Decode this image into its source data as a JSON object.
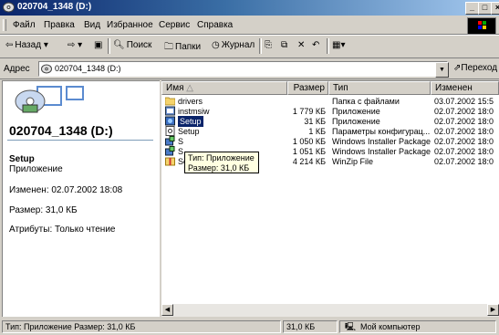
{
  "window": {
    "title": "020704_1348 (D:)",
    "btn_min": "_",
    "btn_max": "□",
    "btn_close": "×"
  },
  "menu": {
    "items": [
      "Файл",
      "Правка",
      "Вид",
      "Избранное",
      "Сервис",
      "Справка"
    ]
  },
  "toolbar": {
    "back": "Назад",
    "search": "Поиск",
    "folders": "Папки",
    "history": "Журнал"
  },
  "address": {
    "label": "Адрес",
    "value": "020704_1348 (D:)",
    "go": "Переход"
  },
  "left_panel": {
    "drive_title": "020704_1348 (D:)",
    "selected_name": "Setup",
    "selected_type": "Приложение",
    "changed": "Изменен: 02.07.2002 18:08",
    "size": "Размер: 31,0 КБ",
    "attributes": "Атрибуты: Только чтение"
  },
  "columns": {
    "name": "Имя",
    "size": "Размер",
    "type": "Тип",
    "modified": "Изменен"
  },
  "files": [
    {
      "name": "drivers",
      "size": "",
      "type": "Папка с файлами",
      "modified": "03.07.2002 15:5",
      "icon": "folder-icon"
    },
    {
      "name": "instmsiw",
      "size": "1 779 КБ",
      "type": "Приложение",
      "modified": "02.07.2002 18:0",
      "icon": "app-icon"
    },
    {
      "name": "Setup",
      "size": "31 КБ",
      "type": "Приложение",
      "modified": "02.07.2002 18:0",
      "icon": "setup-app-icon",
      "selected": true
    },
    {
      "name": "Setup",
      "size": "1 КБ",
      "type": "Параметры конфигурац...",
      "modified": "02.07.2002 18:0",
      "icon": "config-file-icon"
    },
    {
      "name": "S",
      "size": "1 050 КБ",
      "type": "Windows Installer Package",
      "modified": "02.07.2002 18:0",
      "icon": "msi-icon"
    },
    {
      "name": "S",
      "size": "1 051 КБ",
      "type": "Windows Installer Package",
      "modified": "02.07.2002 18:0",
      "icon": "msi-icon"
    },
    {
      "name": "Setup1",
      "size": "4 214 КБ",
      "type": "WinZip File",
      "modified": "02.07.2002 18:0",
      "icon": "winzip-icon"
    }
  ],
  "tooltip": {
    "line1": "Тип: Приложение",
    "line2": "Размер: 31,0 КБ"
  },
  "status": {
    "text": "Тип: Приложение Размер: 31,0 КБ",
    "size": "31,0 КБ",
    "zone": "Мой компьютер"
  }
}
